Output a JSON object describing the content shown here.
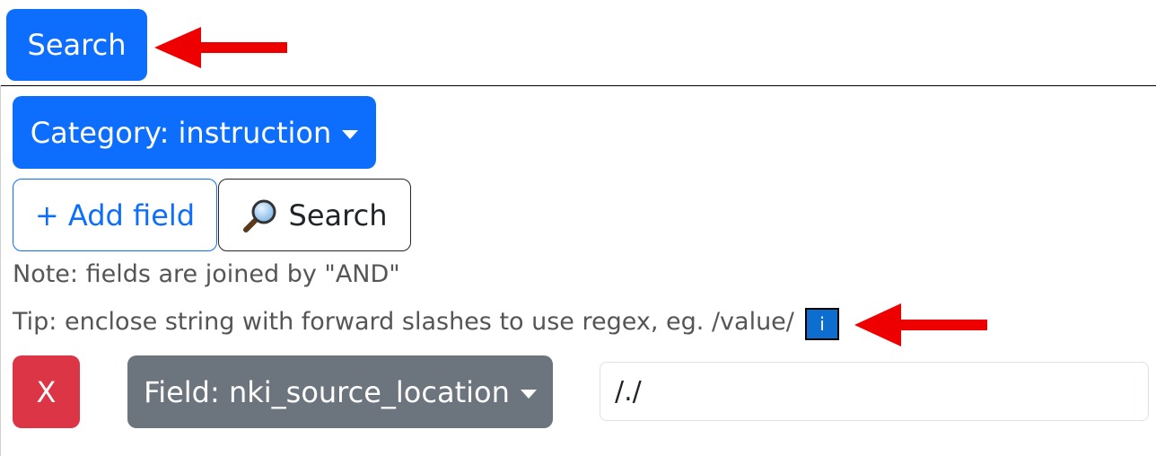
{
  "top": {
    "search_label": "Search"
  },
  "filters": {
    "category_label": "Category: instruction",
    "add_field_label": "+ Add field",
    "search_label": "Search",
    "note": "Note: fields are joined by \"AND\"",
    "tip": "Tip: enclose string with forward slashes to use regex, eg. /value/",
    "info_label": "i"
  },
  "field_row": {
    "remove_label": "X",
    "field_label": "Field: nki_source_location",
    "value": "/./"
  },
  "colors": {
    "primary": "#0d6efd",
    "secondary": "#6c757d",
    "danger": "#dc3545",
    "annotation_arrow": "#ee0000"
  },
  "icons": {
    "search": "magnifying-glass-icon",
    "info": "info-icon",
    "dropdown": "caret-down-icon",
    "annotation": "red-arrow-icon"
  }
}
